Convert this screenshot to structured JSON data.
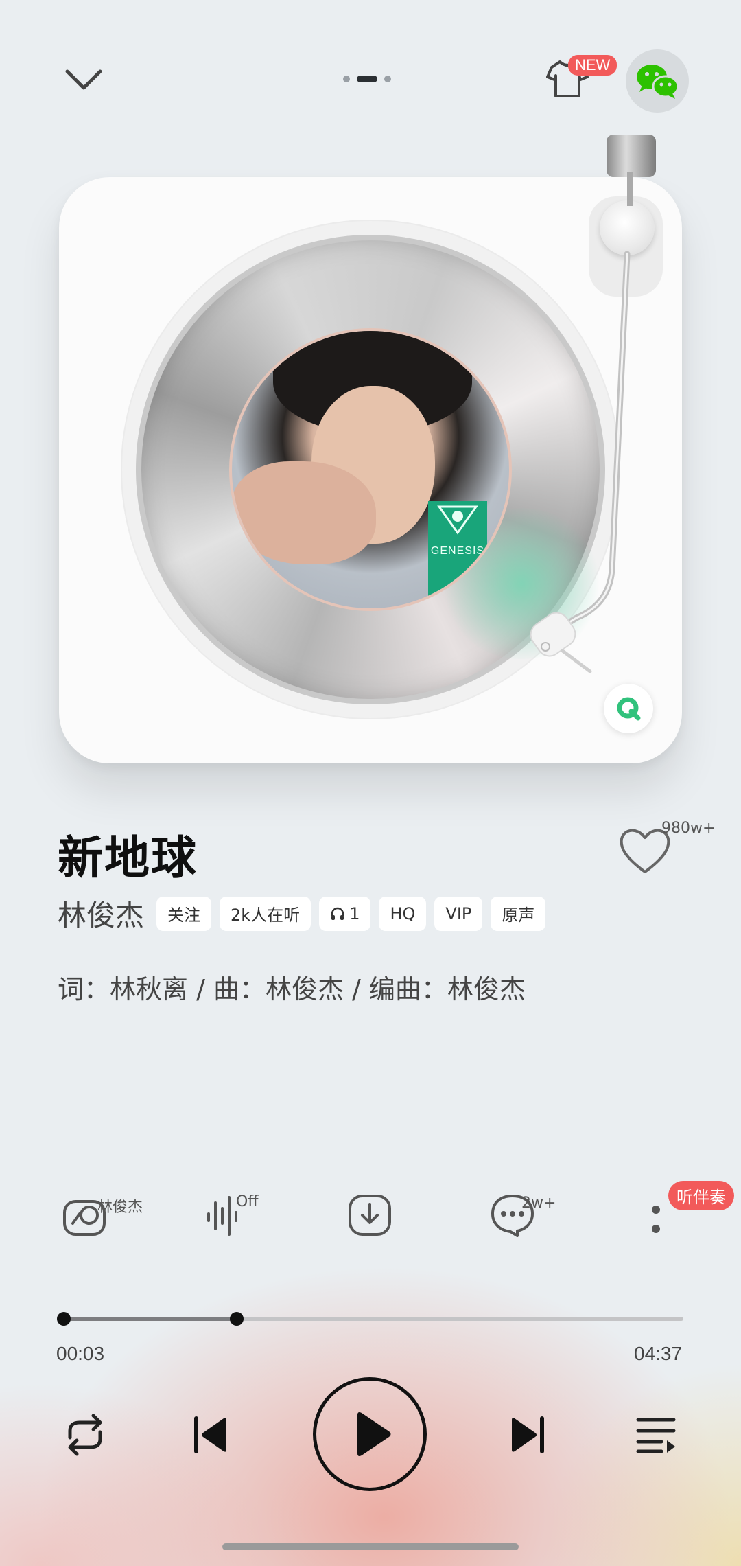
{
  "topbar": {
    "pager": {
      "count": 3,
      "active": 1
    },
    "new_badge": "NEW"
  },
  "song": {
    "title": "新地球",
    "artist": "林俊杰",
    "like_count": "980w+",
    "credits": "词：林秋离 / 曲：林俊杰 / 编曲：林俊杰"
  },
  "chips": {
    "follow": "关注",
    "listeners": "2k人在听",
    "listen_together": "1",
    "quality": "HQ",
    "vip": "VIP",
    "original": "原声"
  },
  "cover": {
    "tag_text": "GENESIS"
  },
  "actions": {
    "singer_label": "林俊杰",
    "effect_label": "Off",
    "comment_count": "2w+",
    "accompany": "听伴奏"
  },
  "progress": {
    "elapsed": "00:03",
    "duration": "04:37",
    "buffered_fraction": 0.28
  },
  "colors": {
    "accent_red": "#f25a5a",
    "wechat_green": "#2dc100",
    "qq_green": "#31c27c"
  }
}
